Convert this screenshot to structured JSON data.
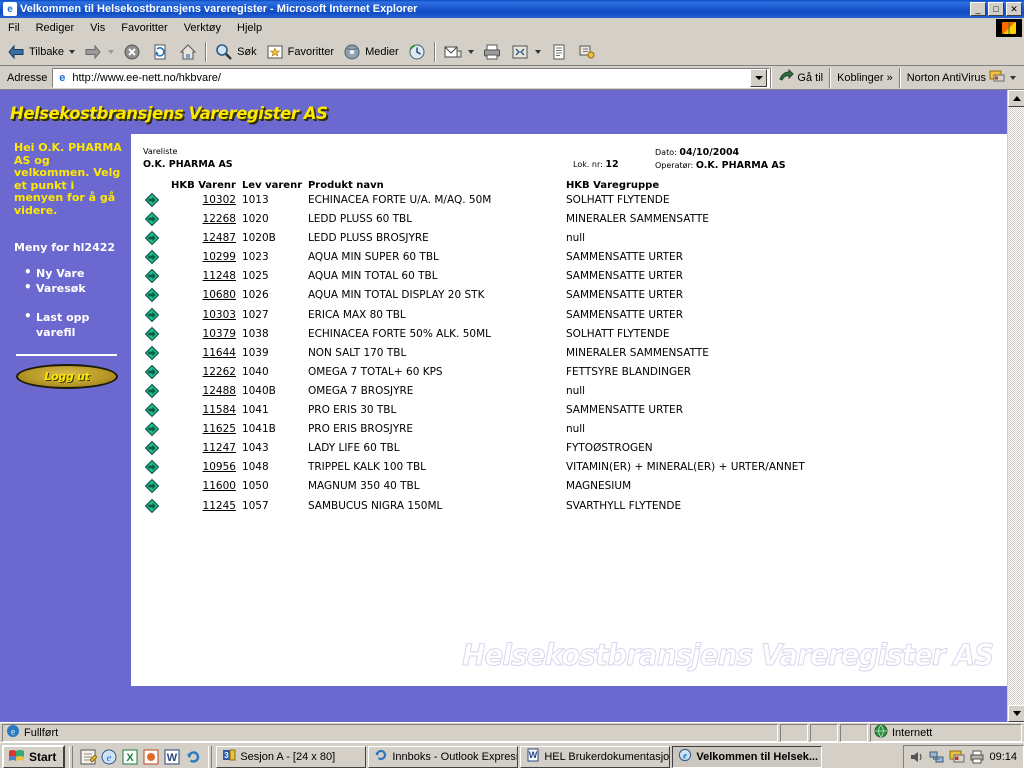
{
  "window": {
    "title": "Velkommen til Helsekostbransjens vareregister - Microsoft Internet Explorer",
    "minimize_label": "_",
    "maximize_label": "□",
    "close_label": "✕"
  },
  "menubar": {
    "items": [
      {
        "label": "Fil"
      },
      {
        "label": "Rediger"
      },
      {
        "label": "Vis"
      },
      {
        "label": "Favoritter"
      },
      {
        "label": "Verktøy"
      },
      {
        "label": "Hjelp"
      }
    ]
  },
  "toolbar": {
    "back_label": "Tilbake",
    "forward_label": "",
    "stop_label": "",
    "refresh_label": "",
    "home_label": "",
    "search_label": "Søk",
    "favorites_label": "Favoritter",
    "media_label": "Medier",
    "history_label": "",
    "mail_label": "",
    "print_label": "",
    "fullscreen_label": "",
    "edit_label": "",
    "discuss_label": ""
  },
  "addressbar": {
    "label": "Adresse",
    "url": "http://www.ee-nett.no/hkbvare/",
    "go_label": "Gå til",
    "links_label": "Koblinger",
    "links_more": "»",
    "antivirus_label": "Norton AntiVirus"
  },
  "page": {
    "banner_title": "Helsekostbransjens Vareregister AS",
    "watermark": "Helsekostbransjens Vareregister AS",
    "sidebar": {
      "welcome": "Hei O.K. PHARMA AS og velkommen. Velg et punkt i menyen for å gå videre.",
      "menu_title": "Meny for hl2422",
      "group1": [
        {
          "label": "Ny Vare"
        },
        {
          "label": "Varesøk"
        }
      ],
      "group2": [
        {
          "label": "Last opp varefil"
        }
      ],
      "logout_label": "Logg ut"
    },
    "document": {
      "list_label": "Vareliste",
      "company": "O.K. PHARMA AS",
      "lot_label": "Lok. nr:",
      "lot_value": "12",
      "date_label": "Dato:",
      "date_value": "04/10/2004",
      "operator_label": "Operatør:",
      "operator_value": "O.K. PHARMA AS",
      "columns": {
        "arrow": "",
        "hkb": "HKB Varenr",
        "lev": "Lev varenr",
        "navn": "Produkt navn",
        "gruppe": "HKB Varegruppe"
      },
      "rows": [
        {
          "hkb": "10302",
          "lev": "1013",
          "navn": "ECHINACEA FORTE U/A. M/AQ. 50M",
          "gruppe": "SOLHATT FLYTENDE"
        },
        {
          "hkb": "12268",
          "lev": "1020",
          "navn": "LEDD PLUSS 60 TBL",
          "gruppe": "MINERALER SAMMENSATTE"
        },
        {
          "hkb": "12487",
          "lev": "1020B",
          "navn": "LEDD PLUSS BROSJYRE",
          "gruppe": "null"
        },
        {
          "hkb": "10299",
          "lev": "1023",
          "navn": "AQUA MIN SUPER 60 TBL",
          "gruppe": "SAMMENSATTE URTER"
        },
        {
          "hkb": "11248",
          "lev": "1025",
          "navn": "AQUA MIN TOTAL 60 TBL",
          "gruppe": "SAMMENSATTE URTER"
        },
        {
          "hkb": "10680",
          "lev": "1026",
          "navn": "AQUA MIN TOTAL DISPLAY 20 STK",
          "gruppe": "SAMMENSATTE URTER"
        },
        {
          "hkb": "10303",
          "lev": "1027",
          "navn": "ERICA MAX 80 TBL",
          "gruppe": "SAMMENSATTE URTER"
        },
        {
          "hkb": "10379",
          "lev": "1038",
          "navn": "ECHINACEA FORTE 50% ALK. 50ML",
          "gruppe": "SOLHATT FLYTENDE"
        },
        {
          "hkb": "11644",
          "lev": "1039",
          "navn": "NON SALT 170 TBL",
          "gruppe": "MINERALER SAMMENSATTE"
        },
        {
          "hkb": "12262",
          "lev": "1040",
          "navn": "OMEGA 7 TOTAL+ 60 KPS",
          "gruppe": "FETTSYRE BLANDINGER"
        },
        {
          "hkb": "12488",
          "lev": "1040B",
          "navn": "OMEGA 7 BROSJYRE",
          "gruppe": "null"
        },
        {
          "hkb": "11584",
          "lev": "1041",
          "navn": "PRO ERIS 30 TBL",
          "gruppe": "SAMMENSATTE URTER"
        },
        {
          "hkb": "11625",
          "lev": "1041B",
          "navn": "PRO ERIS BROSJYRE",
          "gruppe": "null"
        },
        {
          "hkb": "11247",
          "lev": "1043",
          "navn": "LADY LIFE 60 TBL",
          "gruppe": "FYTOØSTROGEN"
        },
        {
          "hkb": "10956",
          "lev": "1048",
          "navn": "TRIPPEL KALK 100 TBL",
          "gruppe": "VITAMIN(ER) + MINERAL(ER) + URTER/ANNET"
        },
        {
          "hkb": "11600",
          "lev": "1050",
          "navn": "MAGNUM 350 40 TBL",
          "gruppe": "MAGNESIUM"
        },
        {
          "hkb": "11245",
          "lev": "1057",
          "navn": "SAMBUCUS NIGRA 150ML",
          "gruppe": "SVARTHYLL FLYTENDE"
        }
      ]
    }
  },
  "statusbar": {
    "text": "Fullført",
    "zone": "Internett"
  },
  "taskbar": {
    "start_label": "Start",
    "tasks": [
      {
        "label": "Sesjon A - [24 x 80]",
        "active": false
      },
      {
        "label": "Innboks - Outlook Express",
        "active": false
      },
      {
        "label": "HEL Brukerdokumentasjo...",
        "active": false
      },
      {
        "label": "Velkommen til Helsek...",
        "active": true
      }
    ],
    "clock": "09:14"
  },
  "colors": {
    "page_purple": "#6b68cf",
    "banner_yellow": "#ffe800",
    "titlebar_blue": "#1957cf",
    "chrome_gray": "#d4d0c8",
    "arrow_green": "#00a878"
  }
}
